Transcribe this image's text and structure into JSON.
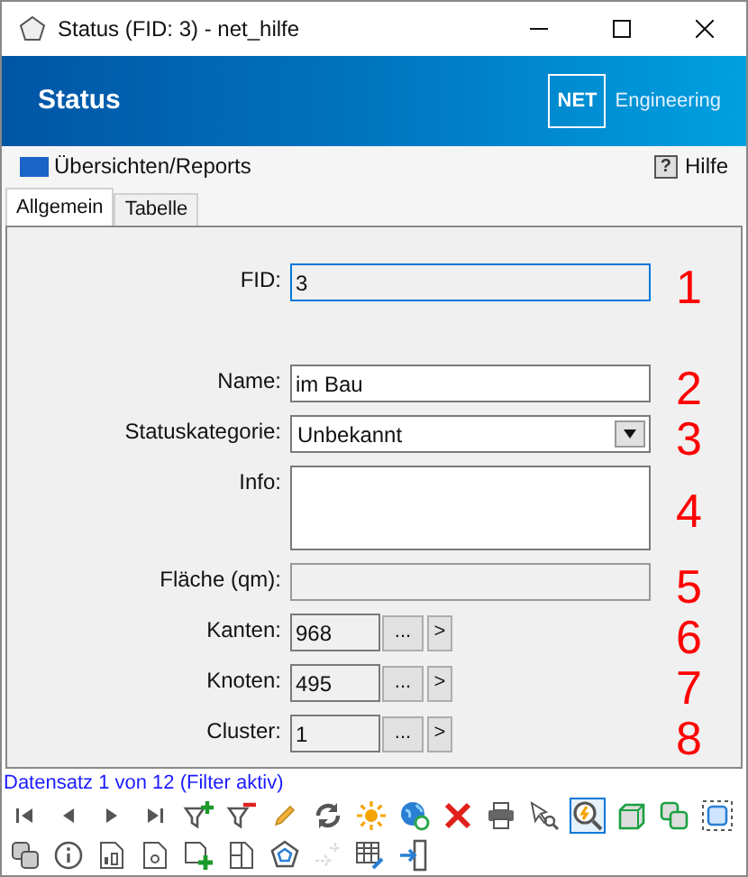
{
  "window": {
    "title": "Status (FID: 3) - net_hilfe"
  },
  "banner": {
    "title": "Status",
    "logo": "NET",
    "brand": "Engineering"
  },
  "menu": {
    "left": "Übersichten/Reports",
    "right": "Hilfe",
    "help_icon": "?"
  },
  "tabs": [
    {
      "label": "Allgemein",
      "selected": true
    },
    {
      "label": "Tabelle",
      "selected": false
    }
  ],
  "fields": [
    {
      "kind": "text",
      "label": "FID:",
      "value": "3",
      "focused": true,
      "disabled": false,
      "marker": "1"
    },
    {
      "kind": "text",
      "label": "Name:",
      "value": "im Bau",
      "focused": false,
      "disabled": false,
      "marker": "2"
    },
    {
      "kind": "select",
      "label": "Statuskategorie:",
      "value": "Unbekannt",
      "marker": "3"
    },
    {
      "kind": "memo",
      "label": "Info:",
      "marker": "4"
    },
    {
      "kind": "text",
      "label": "Fläche (qm):",
      "focused": false,
      "disabled": true,
      "marker": "5"
    },
    {
      "kind": "link",
      "label": "Kanten:",
      "value": "968",
      "dots": "...",
      "go": ">",
      "marker": "6"
    },
    {
      "kind": "link",
      "label": "Knoten:",
      "value": "495",
      "dots": "...",
      "go": ">",
      "marker": "7"
    },
    {
      "kind": "link",
      "label": "Cluster:",
      "value": "1",
      "dots": "...",
      "go": ">",
      "marker": "8"
    }
  ],
  "status_text": "Datensatz 1 von 12 (Filter aktiv)",
  "toolbar": [
    {
      "items": [
        {
          "selected": false,
          "disabled": false
        },
        {
          "selected": false,
          "disabled": false
        },
        {
          "selected": false,
          "disabled": false
        },
        {
          "selected": false,
          "disabled": false
        },
        {
          "selected": false,
          "disabled": false
        },
        {
          "selected": false,
          "disabled": false
        },
        {
          "selected": false,
          "disabled": false
        },
        {
          "selected": false,
          "disabled": false
        },
        {
          "selected": false,
          "disabled": false
        },
        {
          "selected": false,
          "disabled": false
        },
        {
          "selected": false,
          "disabled": false
        },
        {
          "selected": false,
          "disabled": false
        },
        {
          "selected": false,
          "disabled": false
        },
        {
          "selected": true,
          "disabled": false
        },
        {
          "selected": false,
          "disabled": false
        },
        {
          "selected": false,
          "disabled": false
        },
        {
          "selected": false,
          "disabled": false
        }
      ]
    },
    {
      "items": [
        {
          "selected": false,
          "disabled": false
        },
        {
          "selected": false,
          "disabled": false
        },
        {
          "selected": false,
          "disabled": false
        },
        {
          "selected": false,
          "disabled": false
        },
        {
          "selected": false,
          "disabled": false
        },
        {
          "selected": false,
          "disabled": false
        },
        {
          "selected": false,
          "disabled": false
        },
        {
          "selected": false,
          "disabled": true
        },
        {
          "selected": false,
          "disabled": false
        },
        {
          "selected": false,
          "disabled": false
        }
      ]
    }
  ]
}
